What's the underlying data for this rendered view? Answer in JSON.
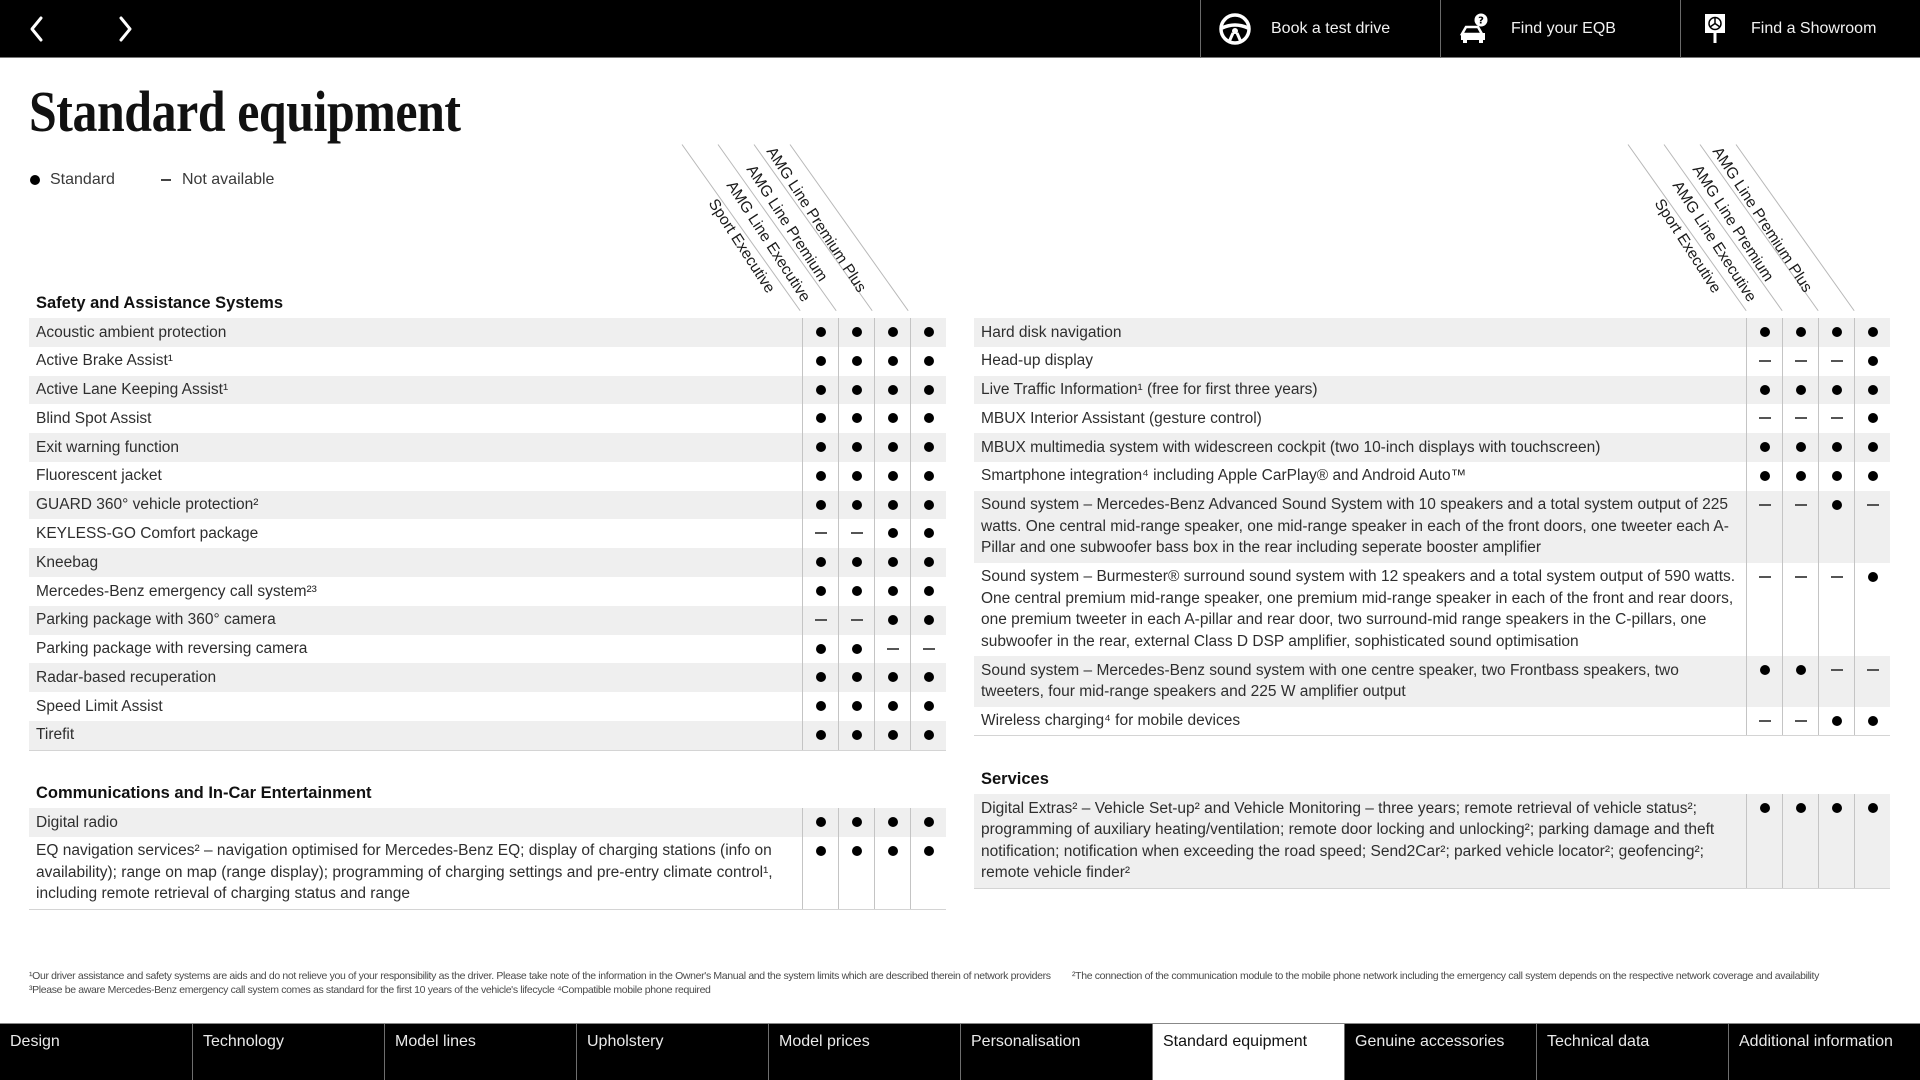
{
  "header": {
    "prev_icon": "chevron-left-icon",
    "next_icon": "chevron-right-icon",
    "buttons": [
      {
        "label": "Book a test drive",
        "icon": "steering-wheel-icon"
      },
      {
        "label": "Find your EQB",
        "icon": "car-question-icon"
      },
      {
        "label": "Find a Showroom",
        "icon": "showroom-sign-icon"
      }
    ]
  },
  "page": {
    "title": "Standard equipment",
    "legend": {
      "standard_label": "Standard",
      "not_available_label": "Not available"
    }
  },
  "columns": [
    "Sport Executive",
    "AMG Line Executive",
    "AMG Line Premium",
    "AMG Line Premium Plus"
  ],
  "left": {
    "sections": [
      {
        "title": "Safety and Assistance Systems",
        "rows": [
          {
            "label": "Acoustic ambient protection",
            "marks": [
              "standard",
              "standard",
              "standard",
              "standard"
            ]
          },
          {
            "label": "Active Brake Assist¹",
            "marks": [
              "standard",
              "standard",
              "standard",
              "standard"
            ]
          },
          {
            "label": "Active Lane Keeping Assist¹",
            "marks": [
              "standard",
              "standard",
              "standard",
              "standard"
            ]
          },
          {
            "label": "Blind Spot Assist",
            "marks": [
              "standard",
              "standard",
              "standard",
              "standard"
            ]
          },
          {
            "label": "Exit warning function",
            "marks": [
              "standard",
              "standard",
              "standard",
              "standard"
            ]
          },
          {
            "label": "Fluorescent jacket",
            "marks": [
              "standard",
              "standard",
              "standard",
              "standard"
            ]
          },
          {
            "label": "GUARD 360° vehicle protection²",
            "marks": [
              "standard",
              "standard",
              "standard",
              "standard"
            ]
          },
          {
            "label": "KEYLESS-GO Comfort package",
            "marks": [
              "na",
              "na",
              "standard",
              "standard"
            ]
          },
          {
            "label": "Kneebag",
            "marks": [
              "standard",
              "standard",
              "standard",
              "standard"
            ]
          },
          {
            "label": "Mercedes-Benz emergency call system²³",
            "marks": [
              "standard",
              "standard",
              "standard",
              "standard"
            ]
          },
          {
            "label": "Parking package with 360° camera",
            "marks": [
              "na",
              "na",
              "standard",
              "standard"
            ]
          },
          {
            "label": "Parking package with reversing camera",
            "marks": [
              "standard",
              "standard",
              "na",
              "na"
            ]
          },
          {
            "label": "Radar-based recuperation",
            "marks": [
              "standard",
              "standard",
              "standard",
              "standard"
            ]
          },
          {
            "label": "Speed Limit Assist",
            "marks": [
              "standard",
              "standard",
              "standard",
              "standard"
            ]
          },
          {
            "label": "Tirefit",
            "marks": [
              "standard",
              "standard",
              "standard",
              "standard"
            ]
          }
        ]
      },
      {
        "title": "Communications and In-Car Entertainment",
        "rows": [
          {
            "label": "Digital radio",
            "marks": [
              "standard",
              "standard",
              "standard",
              "standard"
            ]
          },
          {
            "label": "EQ navigation services² – navigation optimised for Mercedes-Benz EQ; display of charging stations (info on availability); range on map (range display); programming of charging settings and pre-entry climate control¹, including remote retrieval of charging status and range",
            "marks": [
              "standard",
              "standard",
              "standard",
              "standard"
            ]
          }
        ]
      }
    ]
  },
  "right": {
    "sections": [
      {
        "title": "",
        "rows": [
          {
            "label": "Hard disk navigation",
            "marks": [
              "standard",
              "standard",
              "standard",
              "standard"
            ]
          },
          {
            "label": "Head-up display",
            "marks": [
              "na",
              "na",
              "na",
              "standard"
            ]
          },
          {
            "label": "Live Traffic Information¹ (free for first three years)",
            "marks": [
              "standard",
              "standard",
              "standard",
              "standard"
            ]
          },
          {
            "label": "MBUX Interior Assistant (gesture control)",
            "marks": [
              "na",
              "na",
              "na",
              "standard"
            ]
          },
          {
            "label": "MBUX multimedia system with widescreen cockpit (two 10-inch displays with touchscreen)",
            "marks": [
              "standard",
              "standard",
              "standard",
              "standard"
            ]
          },
          {
            "label": "Smartphone integration⁴ including Apple CarPlay® and Android Auto™",
            "marks": [
              "standard",
              "standard",
              "standard",
              "standard"
            ]
          },
          {
            "label": "Sound system – Mercedes-Benz Advanced Sound System with 10 speakers and a total system output of 225 watts. One central mid-range speaker, one mid-range speaker in each of the front doors, one tweeter each A-Pillar and one subwoofer bass box in the rear including seperate booster amplifier",
            "marks": [
              "na",
              "na",
              "standard",
              "na"
            ]
          },
          {
            "label": "Sound system – Burmester® surround sound system with 12 speakers and a total system output of 590 watts. One central premium mid-range speaker, one premium mid-range speaker in each of the front and rear doors, one premium tweeter in each A-pillar and rear door, two surround-mid range speakers in the C-pillars, one subwoofer in the rear, external Class D DSP amplifier, sophisticated sound optimisation",
            "marks": [
              "na",
              "na",
              "na",
              "standard"
            ]
          },
          {
            "label": "Sound system – Mercedes-Benz sound system with one centre speaker, two Frontbass speakers, two tweeters, four mid-range speakers and 225 W amplifier output",
            "marks": [
              "standard",
              "standard",
              "na",
              "na"
            ]
          },
          {
            "label": "Wireless charging⁴ for mobile devices",
            "marks": [
              "na",
              "na",
              "standard",
              "standard"
            ]
          }
        ]
      },
      {
        "title": "Services",
        "rows": [
          {
            "label": "Digital Extras² – Vehicle Set-up² and Vehicle Monitoring – three years; remote retrieval of vehicle status²; programming of auxiliary heating/ventilation; remote door locking and unlocking²; parking damage and theft notification; notification when exceeding the road speed; Send2Car²; parked vehicle locator²; geofencing²; remote vehicle finder²",
            "marks": [
              "standard",
              "standard",
              "standard",
              "standard"
            ]
          }
        ]
      }
    ]
  },
  "footnotes": {
    "left": "¹Our driver assistance and safety systems are aids and do not relieve you of your responsibility as the driver. Please take note of the information in the Owner's Manual and the system limits which are described therein of network providers     ³Please be aware Mercedes-Benz emergency call system comes as standard for the first 10 years of the vehicle's lifecycle     ⁴Compatible mobile phone required",
    "right": "²The connection of the communication module to the mobile phone network including the emergency call system depends on the respective network coverage and availability"
  },
  "bottom_nav": {
    "active": "Standard equipment",
    "tabs": [
      "Design",
      "Technology",
      "Model lines",
      "Upholstery",
      "Model prices",
      "Personalisation",
      "Standard equipment",
      "Genuine accessories",
      "Technical data",
      "Additional information"
    ]
  }
}
